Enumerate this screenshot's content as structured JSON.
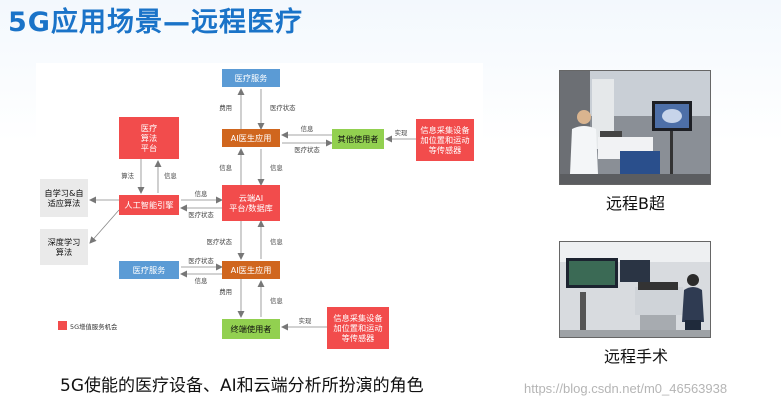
{
  "title": "5G应用场景—远程医疗",
  "caption": "5G使能的医疗设备、AI和云端分析所扮演的角色",
  "watermark": "https://blog.csdn.net/m0_46563938",
  "photos": [
    {
      "label": "远程B超"
    },
    {
      "label": "远程手术"
    }
  ],
  "colors": {
    "red": "#f24c4c",
    "green": "#92d050",
    "blue": "#5b9bd5",
    "orange": "#d0661e",
    "gray": "#eaeaea",
    "title": "#1a73c8"
  },
  "diagram": {
    "boxes": [
      {
        "id": "medical-service-top",
        "lines": [
          "医疗服务"
        ],
        "color": "blue"
      },
      {
        "id": "ai-doctor-top",
        "lines": [
          "AI医生应用"
        ],
        "color": "orange"
      },
      {
        "id": "other-users",
        "lines": [
          "其他使用者"
        ],
        "color": "green"
      },
      {
        "id": "sensors-top",
        "lines": [
          "信息采集设备",
          "加位置和运动",
          "等传感器"
        ],
        "color": "red"
      },
      {
        "id": "medical-algorithm-platform",
        "lines": [
          "医疗",
          "算法",
          "平台"
        ],
        "color": "red"
      },
      {
        "id": "ai-engine",
        "lines": [
          "人工智能引擎"
        ],
        "color": "red"
      },
      {
        "id": "cloud-platform",
        "lines": [
          "云端AI",
          "平台/数据库"
        ],
        "color": "red"
      },
      {
        "id": "self-learning",
        "lines": [
          "自学习&自",
          "适应算法"
        ],
        "color": "gray"
      },
      {
        "id": "deep-learning",
        "lines": [
          "深度学习",
          "算法"
        ],
        "color": "gray"
      },
      {
        "id": "medical-service-bottom",
        "lines": [
          "医疗服务"
        ],
        "color": "blue"
      },
      {
        "id": "ai-doctor-bottom",
        "lines": [
          "AI医生应用"
        ],
        "color": "orange"
      },
      {
        "id": "terminal-users",
        "lines": [
          "终端使用者"
        ],
        "color": "green"
      },
      {
        "id": "sensors-bottom",
        "lines": [
          "信息采集设备",
          "加位置和运动",
          "等传感器"
        ],
        "color": "red"
      }
    ],
    "edge_labels": {
      "fee": "费用",
      "medical_status": "医疗状态",
      "info": "信息",
      "implement": "实现",
      "algorithm": "算法"
    },
    "legend": "5G增值服务机会"
  }
}
